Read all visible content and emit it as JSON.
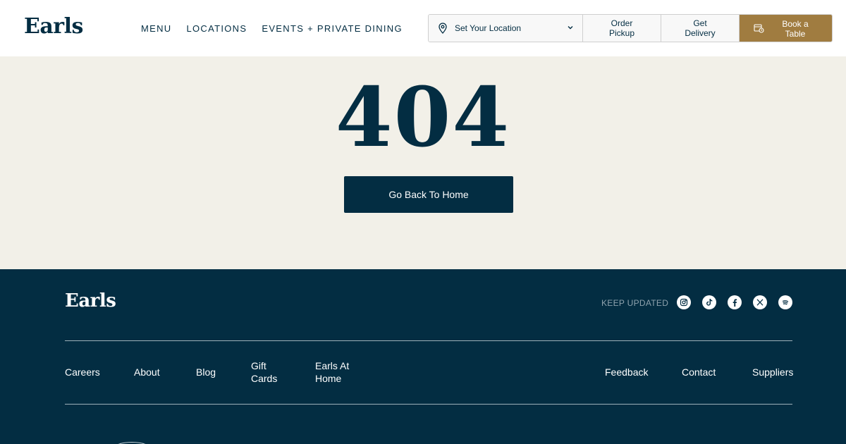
{
  "header": {
    "logo": "Earls",
    "nav": [
      "MENU",
      "LOCATIONS",
      "EVENTS + PRIVATE DINING"
    ],
    "location": {
      "label": "Set Your Location"
    },
    "order_pickup": "Order Pickup",
    "get_delivery": "Get Delivery",
    "book_table": "Book a Table"
  },
  "main": {
    "code": "404",
    "home_button": "Go Back To Home"
  },
  "footer": {
    "logo": "Earls",
    "keep_updated": "KEEP UPDATED",
    "social_icons": [
      "instagram-icon",
      "tiktok-icon",
      "facebook-icon",
      "x-icon",
      "spotify-icon"
    ],
    "links_left": [
      "Careers",
      "About",
      "Blog",
      "Gift Cards",
      "Earls At Home"
    ],
    "links_right": [
      "Feedback",
      "Contact",
      "Suppliers"
    ]
  },
  "colors": {
    "navy": "#032d42",
    "cream": "#f2f0e8",
    "gold": "#a07c40"
  }
}
